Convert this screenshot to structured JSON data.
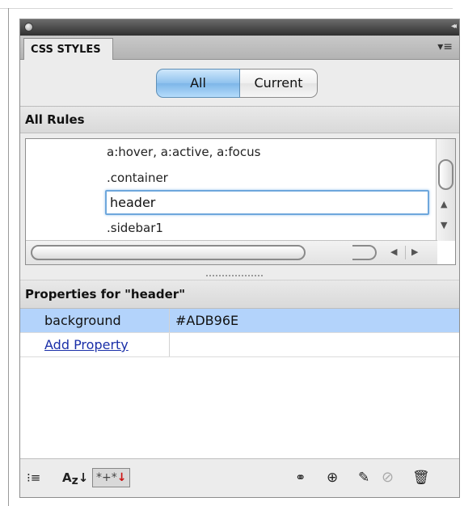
{
  "panel": {
    "tab_label": "CSS STYLES",
    "collapse_glyph": "◂◂",
    "menu_glyph": "▾≡"
  },
  "mode": {
    "all_label": "All",
    "current_label": "Current",
    "selected": "All"
  },
  "all_rules": {
    "heading": "All Rules",
    "rules": [
      "a:hover, a:active, a:focus",
      ".container",
      "header",
      ".sidebar1"
    ],
    "selected_rule": "header"
  },
  "properties": {
    "heading": "Properties for \"header\"",
    "rows": [
      {
        "name": "background",
        "value": "#ADB96E"
      }
    ],
    "add_property_label": "Add Property"
  },
  "toolbar": {
    "icons": [
      "show-category-view-icon",
      "show-alphabetical-view-icon",
      "show-set-properties-only-icon",
      "attach-style-sheet-icon",
      "new-css-rule-icon",
      "edit-rule-icon",
      "disable-property-icon",
      "delete-rule-icon"
    ],
    "category_glyph": "⁝≡",
    "alpha_glyph_a": "A",
    "alpha_glyph_z": "z",
    "alpha_arrow": "↓",
    "setonly_glyph": "*+*",
    "setonly_arrow": "↓",
    "attach_glyph": "⚭",
    "new_glyph": "⊕",
    "edit_glyph": "✎",
    "disable_glyph": "⊘",
    "trash_glyph": "🗑"
  },
  "colors": {
    "selection_row": "#b3d3fb",
    "link": "#1a2fa8",
    "property_value": "#ADB96E"
  }
}
